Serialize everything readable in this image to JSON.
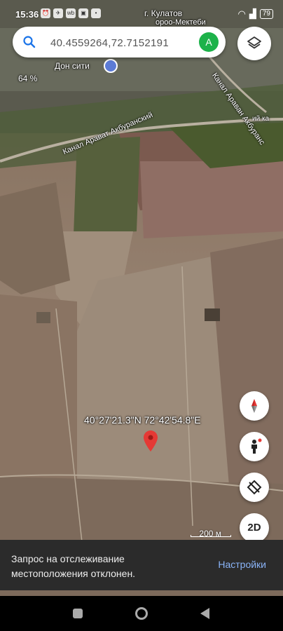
{
  "status_bar": {
    "time": "15:36",
    "battery": "79"
  },
  "search": {
    "value": "40.4559264,72.7152191",
    "account_initial": "A"
  },
  "map": {
    "labels": {
      "town": "г. Кулатов",
      "area": "ороо-Мектеби",
      "poi": "Дон сити",
      "canal_left": "Канал Арават Акбуранский",
      "canal_right": "Канал Араван Акбуранс",
      "canal_right_suffix": "ий ка",
      "percent": "64 %"
    },
    "coordinates": "40°27'21.3\"N 72°42'54.8\"E",
    "scale": "200 м"
  },
  "controls": {
    "mode_label": "2D"
  },
  "snackbar": {
    "message": "Запрос на отслеживание местоположения отклонен.",
    "action": "Настройки"
  },
  "colors": {
    "pin": "#e53935",
    "avatar": "#1db24a",
    "snackbar_action": "#8ab4f8"
  }
}
